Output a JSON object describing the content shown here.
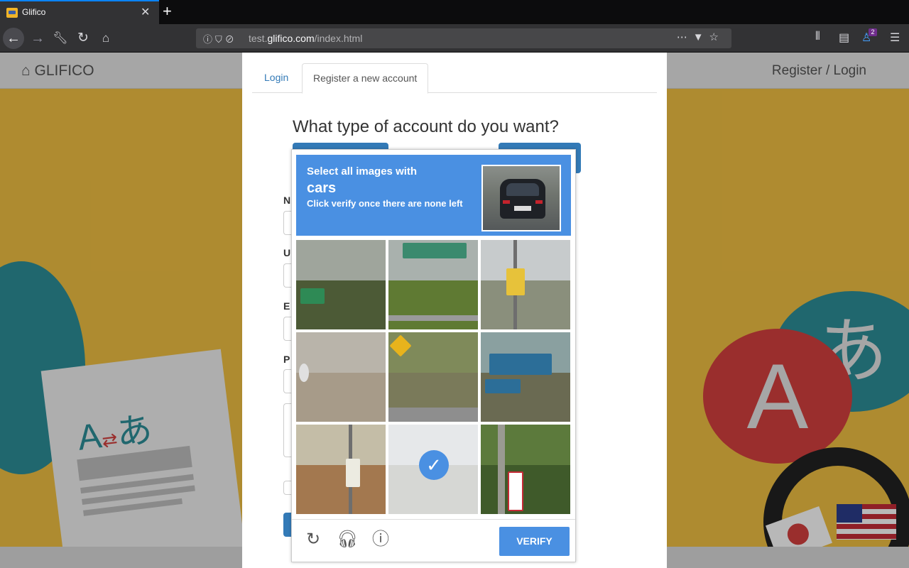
{
  "browser": {
    "tab_title": "Glifico",
    "url_prefix": "test.",
    "url_host": "glifico.com",
    "url_path": "/index.html",
    "notification_count": "2"
  },
  "site": {
    "brand": "GLIFICO",
    "login_link": "Register / Login"
  },
  "modal": {
    "tabs": [
      {
        "label": "Login",
        "active": false
      },
      {
        "label": "Register a new account",
        "active": true
      }
    ],
    "question": "What type of account do you want?",
    "field_initials": [
      "N",
      "U",
      "E",
      "P"
    ]
  },
  "captcha": {
    "prompt_pre": "Select all images with",
    "prompt_target": "cars",
    "prompt_post": "Click verify once there are none left",
    "tiles": [
      {
        "id": 1,
        "selected": false
      },
      {
        "id": 2,
        "selected": false
      },
      {
        "id": 3,
        "selected": false
      },
      {
        "id": 4,
        "selected": false
      },
      {
        "id": 5,
        "selected": false
      },
      {
        "id": 6,
        "selected": false
      },
      {
        "id": 7,
        "selected": false
      },
      {
        "id": 8,
        "selected": true
      },
      {
        "id": 9,
        "selected": false
      }
    ],
    "verify_label": "VERIFY"
  },
  "art": {
    "letter_a": "A",
    "letter_hiragana": "あ"
  },
  "colors": {
    "captcha_blue": "#4a90e2",
    "hero_yellow": "#f2c143",
    "link_blue": "#337ab7"
  }
}
